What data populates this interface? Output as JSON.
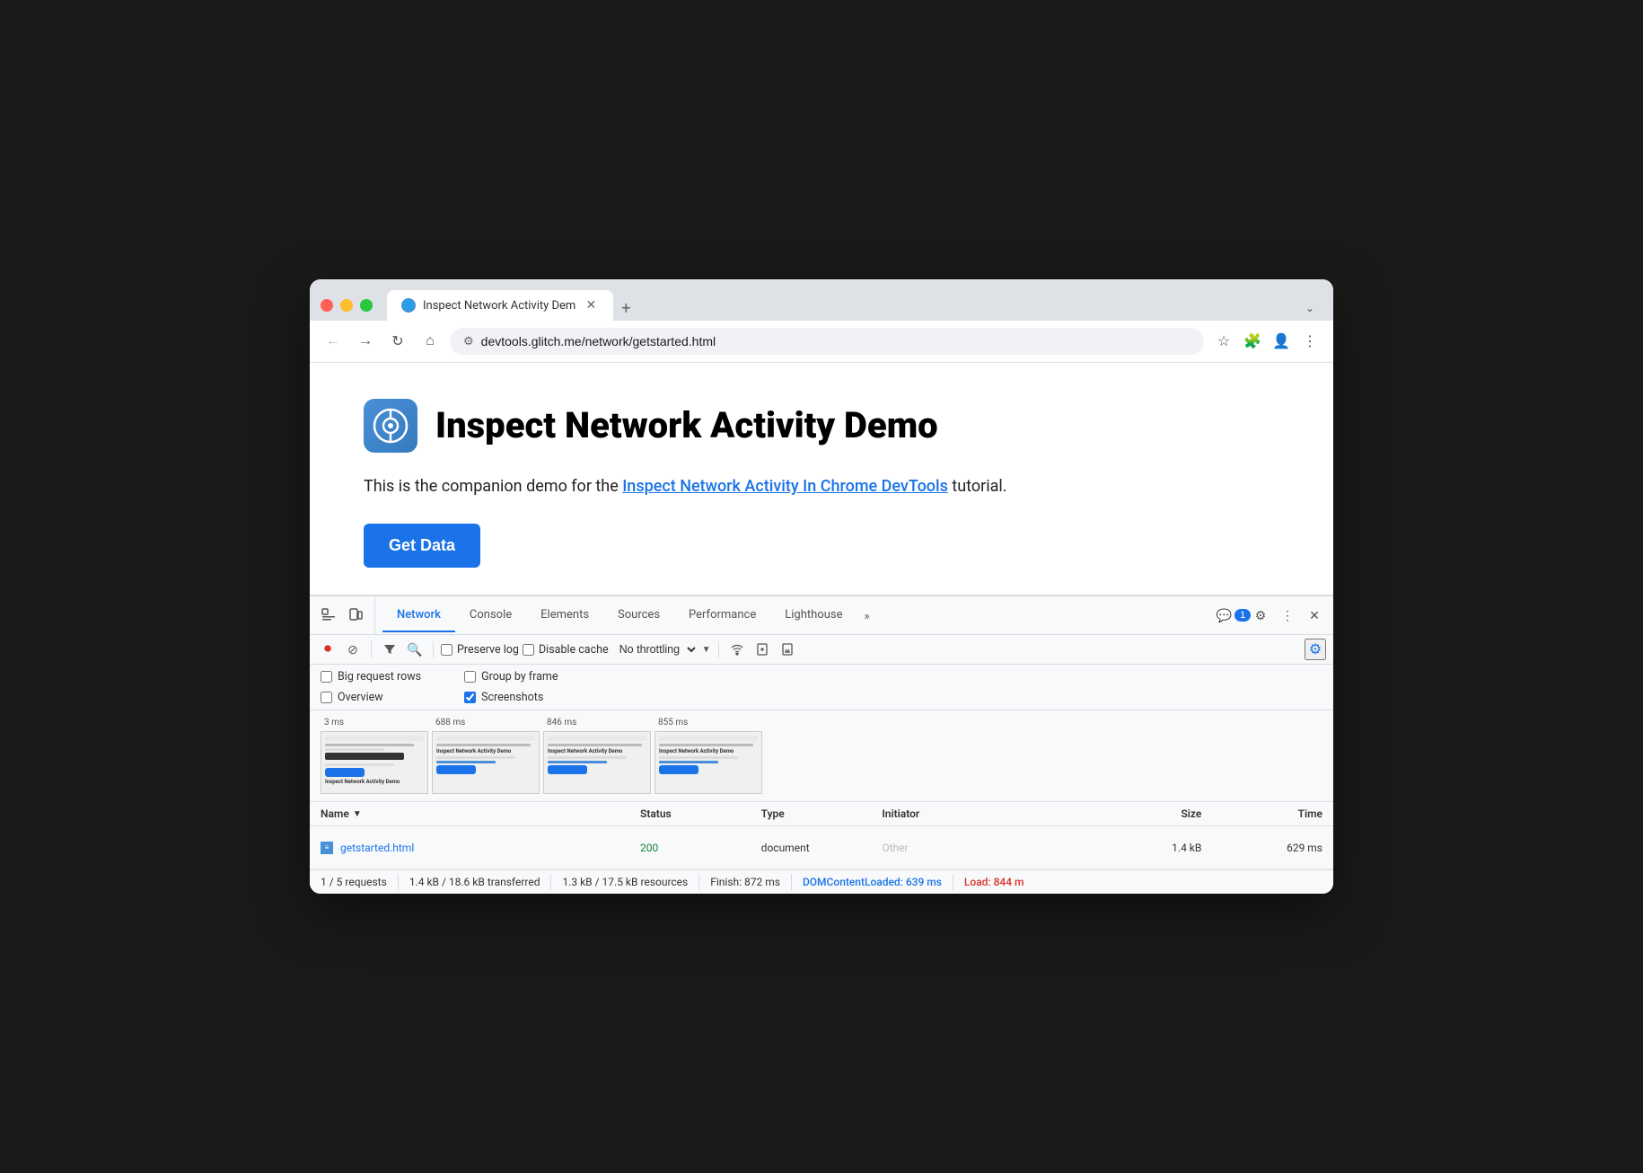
{
  "browser": {
    "tab": {
      "title": "Inspect Network Activity Dem",
      "icon": "🌐"
    },
    "new_tab_label": "+",
    "chevron_label": "⌄",
    "nav": {
      "back_disabled": true,
      "forward_disabled": true,
      "reload_label": "↻",
      "home_label": "⌂",
      "url": "devtools.glitch.me/network/getstarted.html",
      "bookmark_label": "☆",
      "extensions_label": "🧩",
      "more_label": "⋮"
    }
  },
  "page": {
    "logo_alt": "Chrome DevTools logo",
    "title": "Inspect Network Activity Demo",
    "description_prefix": "This is the companion demo for the ",
    "description_link": "Inspect Network Activity In Chrome DevTools",
    "description_suffix": " tutorial.",
    "button_label": "Get Data"
  },
  "devtools": {
    "tabs": [
      {
        "label": "Network",
        "active": true
      },
      {
        "label": "Console",
        "active": false
      },
      {
        "label": "Elements",
        "active": false
      },
      {
        "label": "Sources",
        "active": false
      },
      {
        "label": "Performance",
        "active": false
      },
      {
        "label": "Lighthouse",
        "active": false
      }
    ],
    "tabs_more_label": "»",
    "badge_count": "1",
    "toolbar": {
      "record_btn": "⏺",
      "clear_btn": "🚫",
      "filter_btn": "⛉",
      "search_btn": "🔍",
      "preserve_log_label": "Preserve log",
      "disable_cache_label": "Disable cache",
      "throttle_label": "No throttling",
      "wifi_icon": "📶",
      "upload_icon": "⬆",
      "download_icon": "⬇",
      "settings_icon": "⚙"
    },
    "settings": {
      "big_request_rows_label": "Big request rows",
      "overview_label": "Overview",
      "group_by_frame_label": "Group by frame",
      "screenshots_label": "Screenshots",
      "screenshots_checked": true,
      "big_request_rows_checked": false,
      "overview_checked": false,
      "group_by_frame_checked": false
    },
    "screenshots": [
      {
        "time": "3 ms",
        "has_content": false
      },
      {
        "time": "688 ms",
        "has_content": true
      },
      {
        "time": "846 ms",
        "has_content": true
      },
      {
        "time": "855 ms",
        "has_content": true
      }
    ],
    "table": {
      "headers": {
        "name": "Name",
        "status": "Status",
        "type": "Type",
        "initiator": "Initiator",
        "size": "Size",
        "time": "Time"
      },
      "rows": [
        {
          "name": "getstarted.html",
          "status": "200",
          "type": "document",
          "initiator": "Other",
          "size": "1.4 kB",
          "time": "629 ms"
        }
      ]
    },
    "status_bar": {
      "requests": "1 / 5 requests",
      "transferred": "1.4 kB / 18.6 kB transferred",
      "resources": "1.3 kB / 17.5 kB resources",
      "finish": "Finish: 872 ms",
      "dom_loaded": "DOMContentLoaded: 639 ms",
      "load": "Load: 844 m"
    }
  }
}
